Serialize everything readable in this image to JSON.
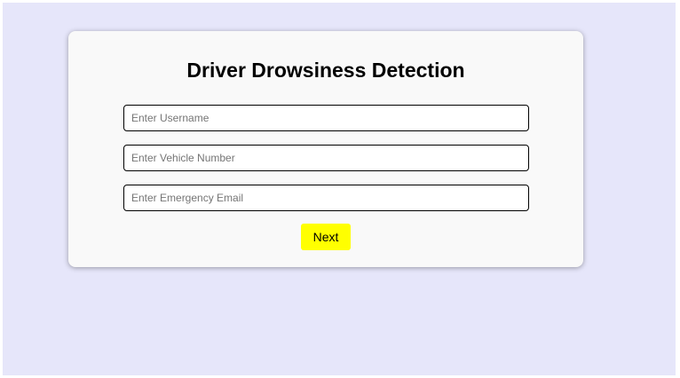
{
  "form": {
    "title": "Driver Drowsiness Detection",
    "username_placeholder": "Enter Username",
    "username_value": "",
    "vehicle_placeholder": "Enter Vehicle Number",
    "vehicle_value": "",
    "email_placeholder": "Enter Emergency Email",
    "email_value": "",
    "next_label": "Next"
  },
  "colors": {
    "page_background": "#e6e6fa",
    "card_background": "#f9f9f9",
    "button_accent": "#ffff00"
  }
}
